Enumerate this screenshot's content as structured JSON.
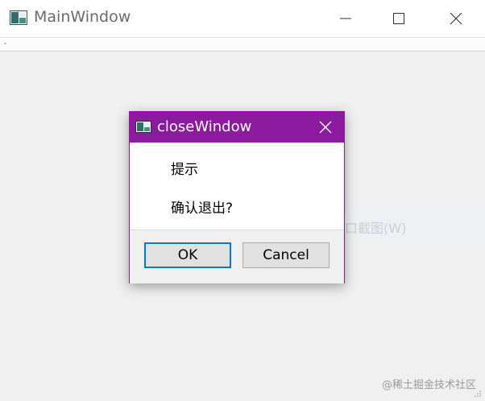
{
  "window": {
    "title": "MainWindow",
    "controls": {
      "minimize": "minimize",
      "maximize": "maximize",
      "close": "close"
    }
  },
  "background_menu": {
    "label": "窗口截图(W)"
  },
  "dialog": {
    "title": "closeWindow",
    "accent_color": "#8b1a9e",
    "message_title": "提示",
    "message_body": "确认退出?",
    "buttons": {
      "ok": "OK",
      "cancel": "Cancel"
    }
  },
  "watermark": "@稀土掘金技术社区",
  "icons": [
    "app-icon",
    "minimize-icon",
    "maximize-icon",
    "close-icon",
    "dialog-app-icon",
    "dialog-close-icon",
    "size-grip-icon"
  ]
}
